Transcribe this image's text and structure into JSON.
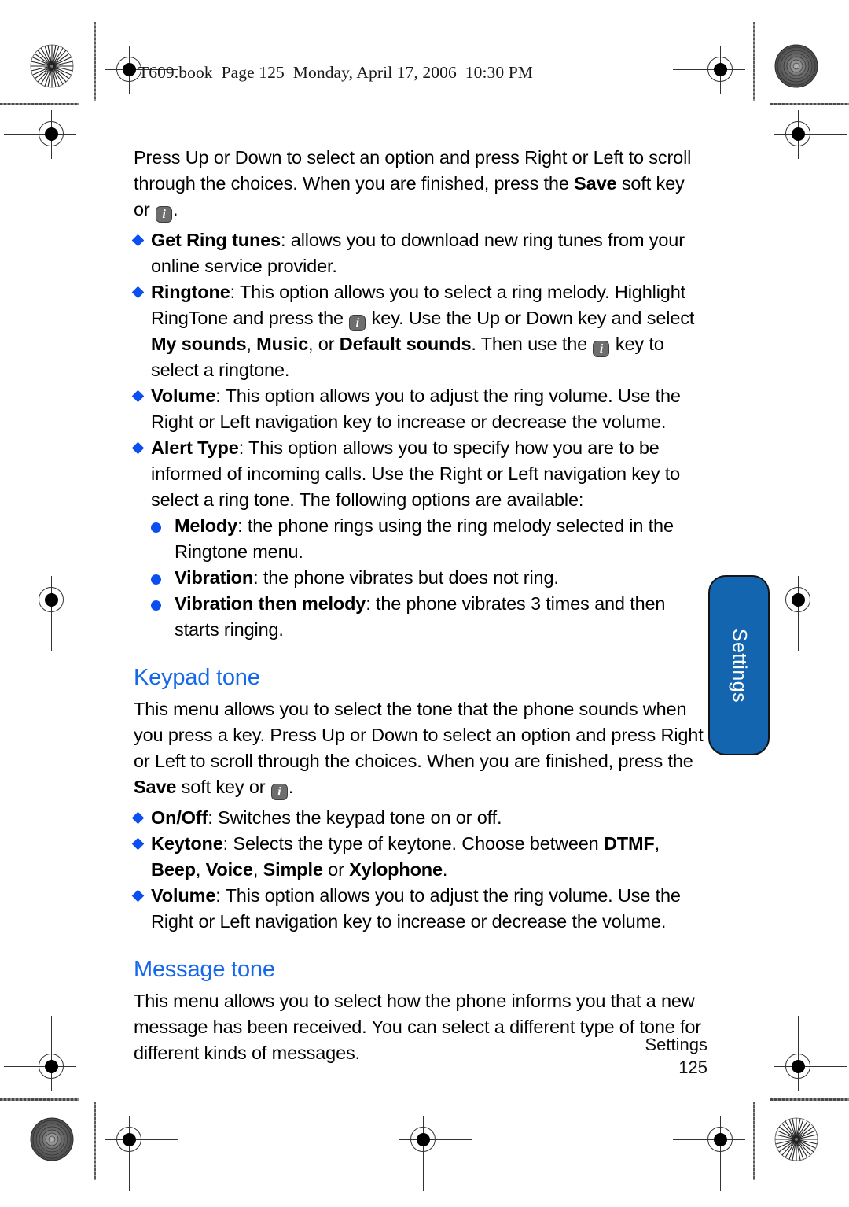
{
  "page": {
    "book_header": "T609.book  Page 125  Monday, April 17, 2006  10:30 PM",
    "accent_blue": "#1568ec",
    "bullet_blue": "#0b4ff0",
    "tab_blue": "#1265ae"
  },
  "side_tab": {
    "label": "Settings"
  },
  "footer": {
    "section": "Settings",
    "page_number": "125"
  },
  "body": {
    "intro": {
      "part1": "Press Up or Down to select an option and press Right or Left to scroll through the choices. When you are finished, press the ",
      "bold1": "Save",
      "part2": " soft key or ",
      "key_icon": "i",
      "part3": "."
    },
    "bullets_sound": [
      {
        "term": "Get Ring tunes",
        "text": ": allows you to download new ring tunes from your online service provider."
      },
      {
        "term": "Ringtone",
        "text": ": This option allows you to select a ring melody. Highlight RingTone and press the ",
        "text2": " key. Use the Up or Down key and select ",
        "bold_a": "My sounds",
        "sep_a": ", ",
        "bold_b": "Music",
        "sep_b": ", or ",
        "bold_c": "Default sounds",
        "text3": ". Then use the ",
        "text4": " key to select a ringtone."
      },
      {
        "term": "Volume",
        "text": ": This option allows you to adjust the ring volume. Use the Right or Left navigation key to increase or decrease the volume."
      },
      {
        "term": "Alert Type",
        "text": ": This option allows you to specify how you are to be informed of incoming calls. Use the Right or Left navigation key to select a ring tone. The following options are available:"
      }
    ],
    "alert_type_options": [
      {
        "term": "Melody",
        "text": ": the phone rings using the ring melody selected in the Ringtone menu."
      },
      {
        "term": "Vibration",
        "text": ": the phone vibrates but does not ring."
      },
      {
        "term": "Vibration then melody",
        "text": ": the phone vibrates 3 times and then starts ringing."
      }
    ],
    "keypad_tone": {
      "heading": "Keypad tone",
      "para_part1": "This menu allows you to select the tone that the phone sounds when you press a key. Press Up or Down to select an option and press Right or Left to scroll through the choices. When you are finished, press the ",
      "para_bold": "Save",
      "para_part2": " soft key or ",
      "para_part3": ".",
      "bullets": [
        {
          "term": "On/Off",
          "text": ": Switches the keypad tone on or off."
        },
        {
          "term": "Keytone",
          "text": ": Selects the type of keytone. Choose between ",
          "opt1": "DTMF",
          "sep1": ", ",
          "opt2": "Beep",
          "sep2": ", ",
          "opt3": "Voice",
          "sep3": ", ",
          "opt4": "Simple",
          "sep4": " or ",
          "opt5": "Xylophone",
          "tail": "."
        },
        {
          "term": "Volume",
          "text": ": This option allows you to adjust the ring volume. Use the Right or Left navigation key to increase or decrease the volume."
        }
      ]
    },
    "message_tone": {
      "heading": "Message tone",
      "para": "This menu allows you to select how the phone informs you that a new message has been received. You can select a different type of tone for different kinds of messages."
    }
  }
}
